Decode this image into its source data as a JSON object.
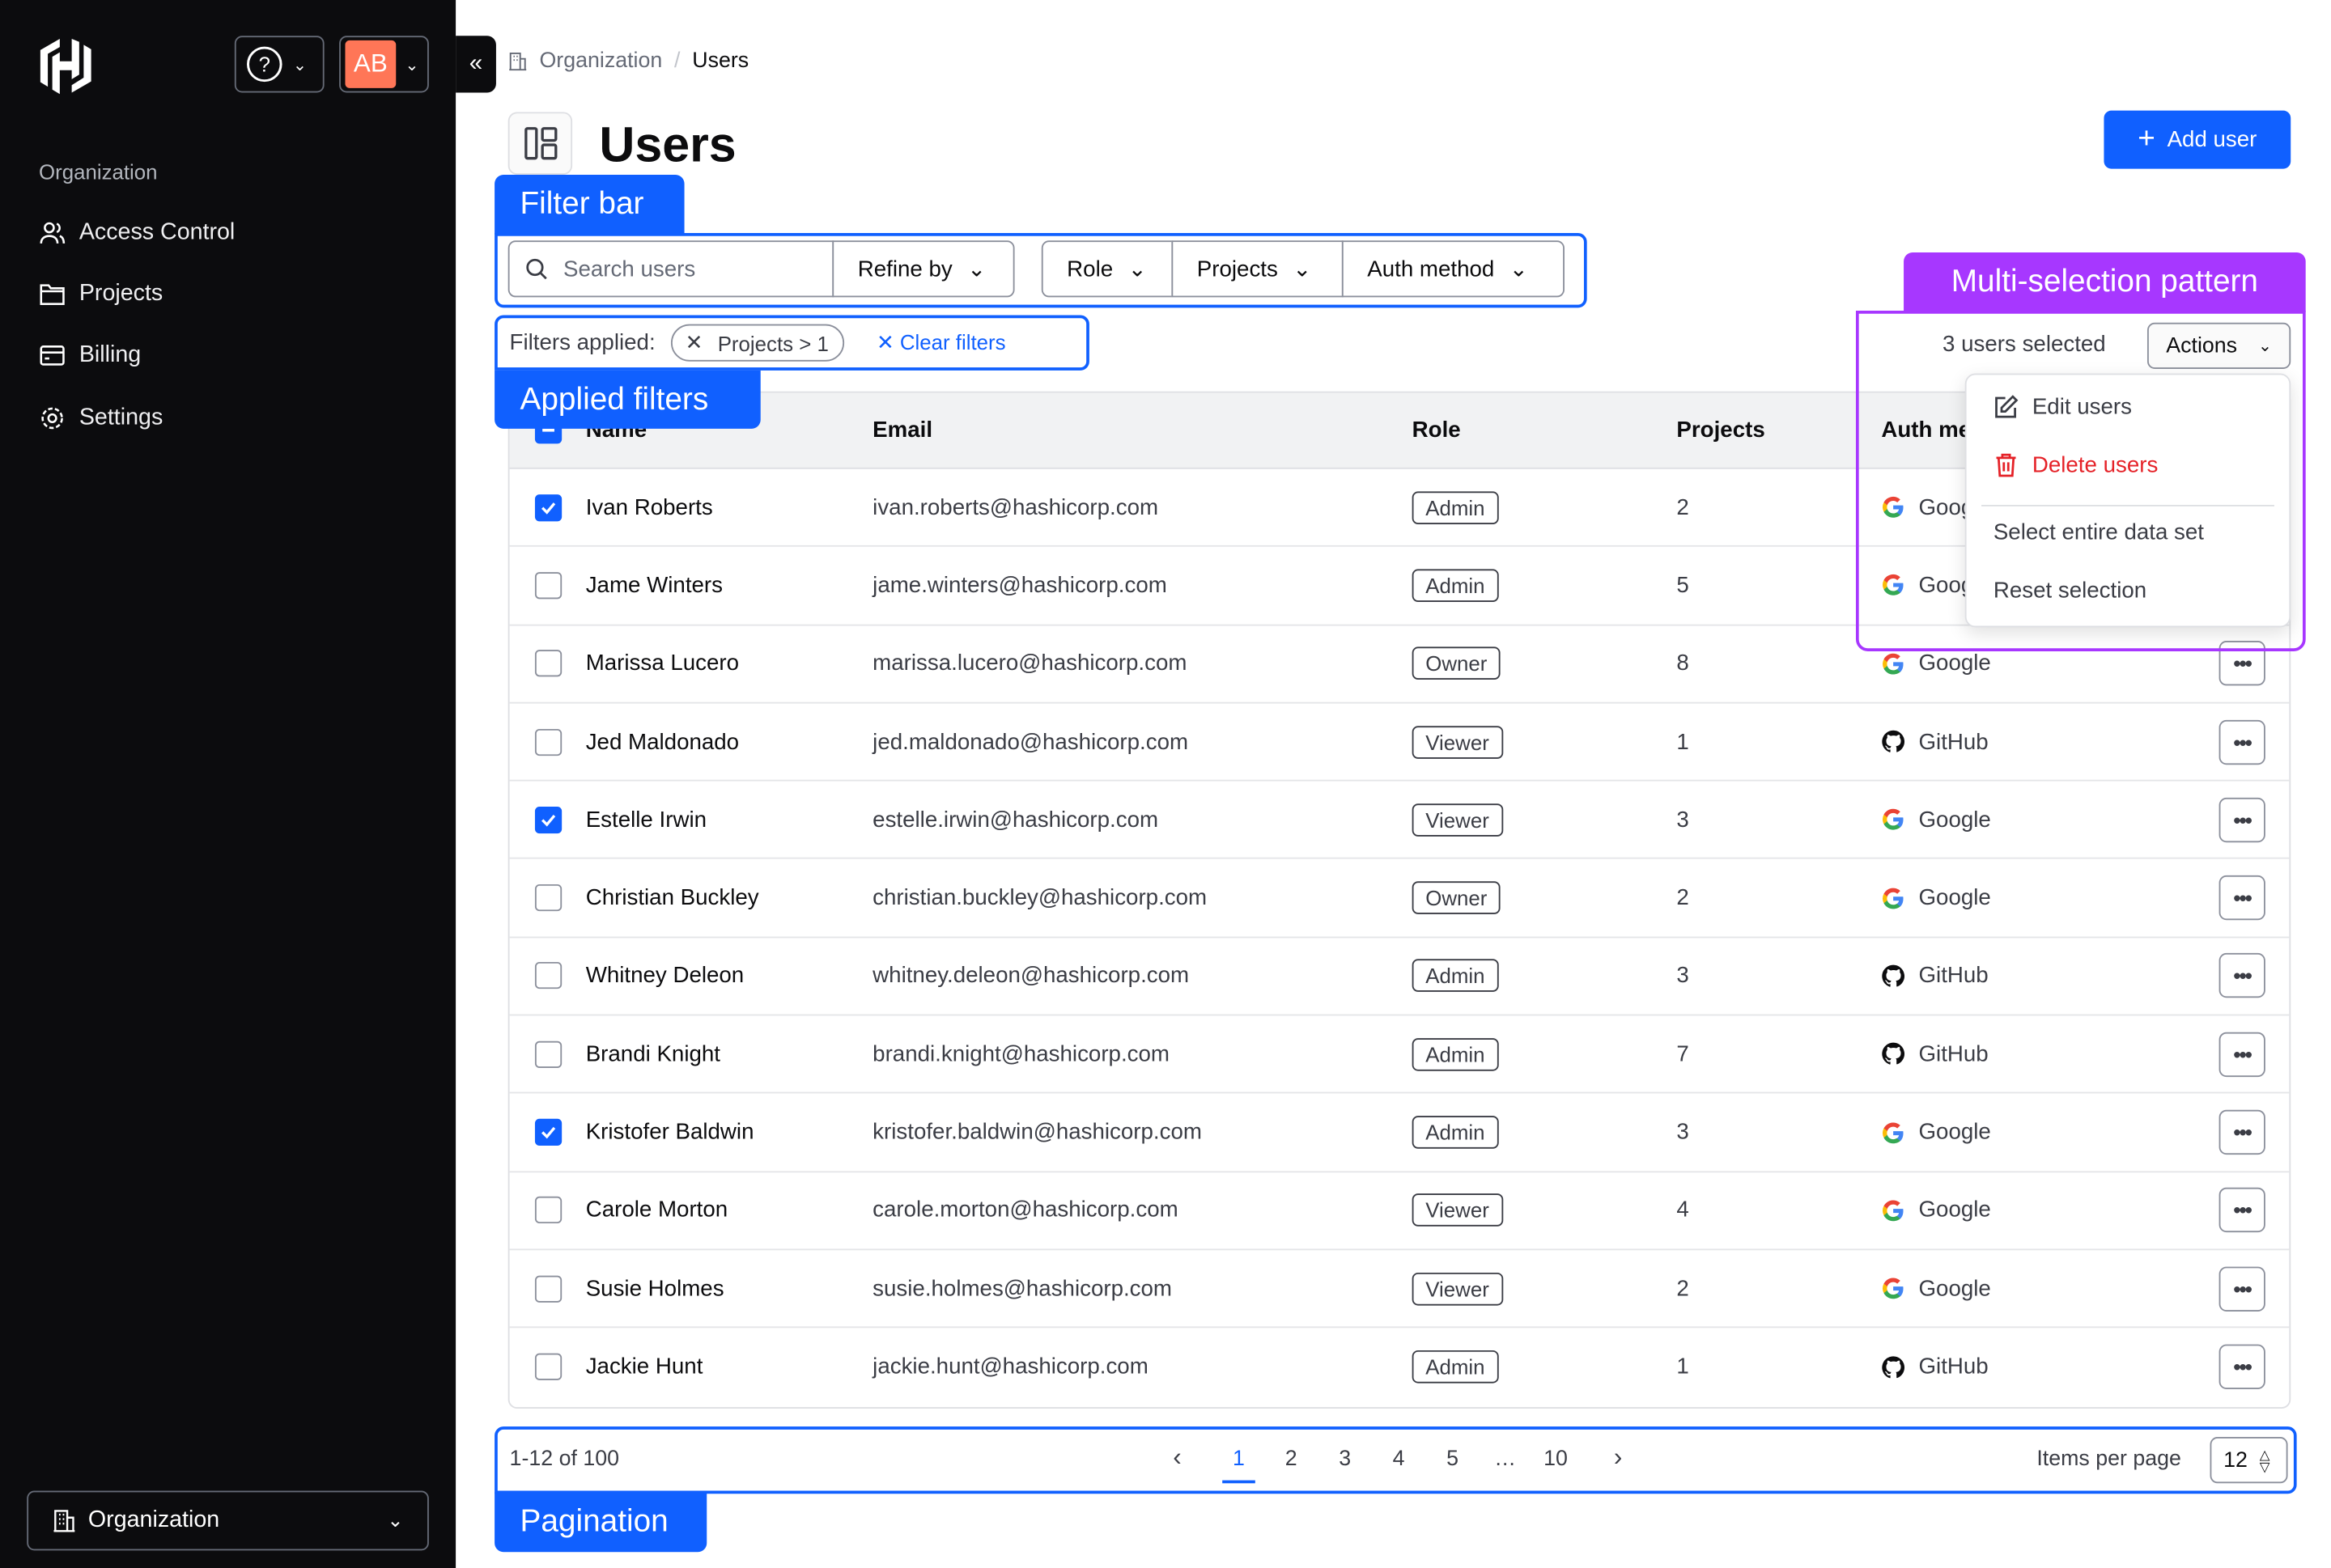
{
  "sidebar": {
    "section_label": "Organization",
    "items": [
      {
        "label": "Access Control",
        "icon": "users-icon"
      },
      {
        "label": "Projects",
        "icon": "folder-icon"
      },
      {
        "label": "Billing",
        "icon": "credit-card-icon"
      },
      {
        "label": "Settings",
        "icon": "gear-icon"
      }
    ],
    "avatar_initials": "AB",
    "org_selector": "Organization"
  },
  "breadcrumb": {
    "parent": "Organization",
    "current": "Users"
  },
  "page": {
    "title": "Users",
    "add_user": "Add user"
  },
  "annotations": {
    "filter_bar": "Filter bar",
    "applied_filters": "Applied filters",
    "multi_selection": "Multi-selection pattern",
    "pagination": "Pagination"
  },
  "filters": {
    "search_placeholder": "Search users",
    "refine_by": "Refine by",
    "role": "Role",
    "projects": "Projects",
    "auth_method": "Auth method",
    "applied_label": "Filters applied:",
    "chip": "Projects > 1",
    "clear": "Clear filters"
  },
  "selection": {
    "count_text": "3 users selected",
    "actions": "Actions",
    "menu": {
      "edit": "Edit users",
      "delete": "Delete users",
      "select_all": "Select entire data set",
      "reset": "Reset selection"
    }
  },
  "table": {
    "columns": [
      "Name",
      "Email",
      "Role",
      "Projects",
      "Auth method"
    ],
    "rows": [
      {
        "name": "Ivan Roberts",
        "email": "ivan.roberts@hashicorp.com",
        "role": "Admin",
        "projects": "2",
        "auth": "Google",
        "checked": true
      },
      {
        "name": "Jame Winters",
        "email": "jame.winters@hashicorp.com",
        "role": "Admin",
        "projects": "5",
        "auth": "Google",
        "checked": false
      },
      {
        "name": "Marissa Lucero",
        "email": "marissa.lucero@hashicorp.com",
        "role": "Owner",
        "projects": "8",
        "auth": "Google",
        "checked": false
      },
      {
        "name": "Jed Maldonado",
        "email": "jed.maldonado@hashicorp.com",
        "role": "Viewer",
        "projects": "1",
        "auth": "GitHub",
        "checked": false
      },
      {
        "name": "Estelle Irwin",
        "email": "estelle.irwin@hashicorp.com",
        "role": "Viewer",
        "projects": "3",
        "auth": "Google",
        "checked": true
      },
      {
        "name": "Christian Buckley",
        "email": "christian.buckley@hashicorp.com",
        "role": "Owner",
        "projects": "2",
        "auth": "Google",
        "checked": false
      },
      {
        "name": "Whitney Deleon",
        "email": "whitney.deleon@hashicorp.com",
        "role": "Admin",
        "projects": "3",
        "auth": "GitHub",
        "checked": false
      },
      {
        "name": "Brandi Knight",
        "email": "brandi.knight@hashicorp.com",
        "role": "Admin",
        "projects": "7",
        "auth": "GitHub",
        "checked": false
      },
      {
        "name": "Kristofer Baldwin",
        "email": "kristofer.baldwin@hashicorp.com",
        "role": "Admin",
        "projects": "3",
        "auth": "Google",
        "checked": true
      },
      {
        "name": "Carole Morton",
        "email": "carole.morton@hashicorp.com",
        "role": "Viewer",
        "projects": "4",
        "auth": "Google",
        "checked": false
      },
      {
        "name": "Susie Holmes",
        "email": "susie.holmes@hashicorp.com",
        "role": "Viewer",
        "projects": "2",
        "auth": "Google",
        "checked": false
      },
      {
        "name": "Jackie Hunt",
        "email": "jackie.hunt@hashicorp.com",
        "role": "Admin",
        "projects": "1",
        "auth": "GitHub",
        "checked": false
      }
    ]
  },
  "pagination": {
    "range": "1-12 of 100",
    "pages": [
      "1",
      "2",
      "3",
      "4",
      "5",
      "…",
      "10"
    ],
    "current": "1",
    "items_per_page_label": "Items per page",
    "items_per_page": "12"
  },
  "colors": {
    "accent": "#1060ff",
    "annotation_purple": "#a737ff",
    "danger": "#e52228",
    "avatar": "#ff7657"
  }
}
